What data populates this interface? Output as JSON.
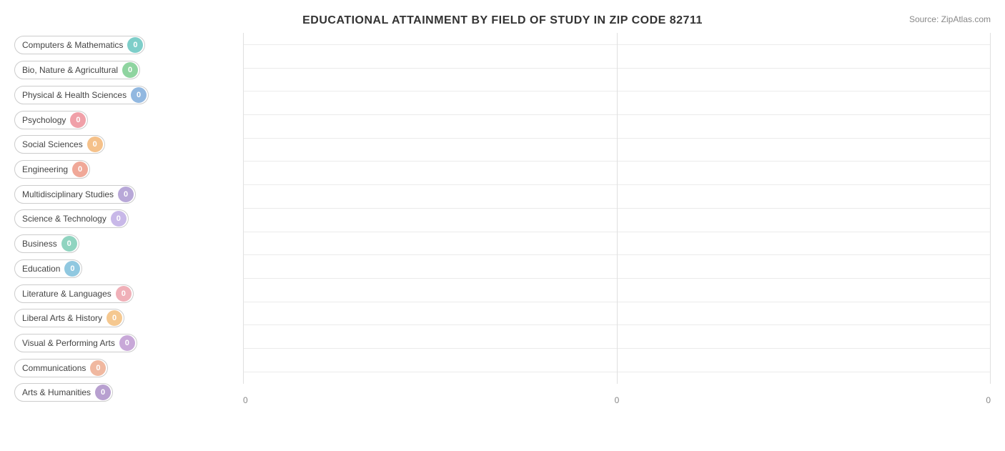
{
  "title": "EDUCATIONAL ATTAINMENT BY FIELD OF STUDY IN ZIP CODE 82711",
  "source": "Source: ZipAtlas.com",
  "bars": [
    {
      "label": "Computers & Mathematics",
      "value": 0,
      "colorClass": "color-teal"
    },
    {
      "label": "Bio, Nature & Agricultural",
      "value": 0,
      "colorClass": "color-green"
    },
    {
      "label": "Physical & Health Sciences",
      "value": 0,
      "colorClass": "color-blue"
    },
    {
      "label": "Psychology",
      "value": 0,
      "colorClass": "color-pink"
    },
    {
      "label": "Social Sciences",
      "value": 0,
      "colorClass": "color-peach"
    },
    {
      "label": "Engineering",
      "value": 0,
      "colorClass": "color-salmon"
    },
    {
      "label": "Multidisciplinary Studies",
      "value": 0,
      "colorClass": "color-purple"
    },
    {
      "label": "Science & Technology",
      "value": 0,
      "colorClass": "color-lavender"
    },
    {
      "label": "Business",
      "value": 0,
      "colorClass": "color-mint"
    },
    {
      "label": "Education",
      "value": 0,
      "colorClass": "color-sky"
    },
    {
      "label": "Literature & Languages",
      "value": 0,
      "colorClass": "color-rose"
    },
    {
      "label": "Liberal Arts & History",
      "value": 0,
      "colorClass": "color-orange"
    },
    {
      "label": "Visual & Performing Arts",
      "value": 0,
      "colorClass": "color-lilac"
    },
    {
      "label": "Communications",
      "value": 0,
      "colorClass": "color-coral"
    },
    {
      "label": "Arts & Humanities",
      "value": 0,
      "colorClass": "color-violet"
    }
  ],
  "xAxisLabels": [
    "0",
    "0",
    "0"
  ],
  "grid_lines_count": 3
}
